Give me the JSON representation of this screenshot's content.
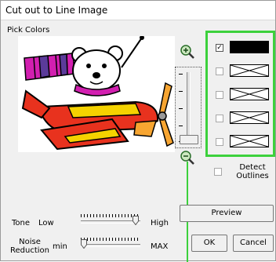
{
  "window": {
    "title": "Cut out to Line Image"
  },
  "pick_colors": {
    "label": "Pick Colors"
  },
  "zoom": {
    "in_icon": "zoom-in-icon",
    "out_icon": "zoom-out-icon"
  },
  "colors": [
    {
      "checked": true,
      "mark": "✓",
      "color": "#000000",
      "empty": false
    },
    {
      "checked": false,
      "mark": "",
      "color": "",
      "empty": true
    },
    {
      "checked": false,
      "mark": "",
      "color": "",
      "empty": true
    },
    {
      "checked": false,
      "mark": "",
      "color": "",
      "empty": true
    },
    {
      "checked": false,
      "mark": "",
      "color": "",
      "empty": true
    }
  ],
  "detect": {
    "label_line1": "Detect",
    "label_line2": "Outlines",
    "checked": false
  },
  "tone": {
    "label": "Tone",
    "min_label": "Low",
    "max_label": "High"
  },
  "noise": {
    "label_line1": "Noise",
    "label_line2": "Reduction",
    "min_label": "min",
    "max_label": "MAX"
  },
  "buttons": {
    "preview": "Preview",
    "ok": "OK",
    "cancel": "Cancel"
  },
  "accent_color": "#3cd13c"
}
